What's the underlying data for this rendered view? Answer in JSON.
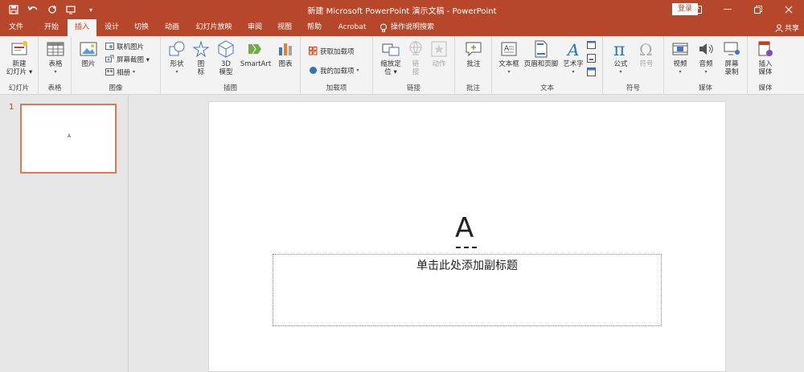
{
  "titlebar": {
    "doc_title": "新建 Microsoft PowerPoint 演示文稿 - PowerPoint",
    "login": "登录"
  },
  "tabs": [
    "文件",
    "开始",
    "插入",
    "设计",
    "切换",
    "动画",
    "幻灯片放映",
    "审阅",
    "视图",
    "帮助",
    "Acrobat",
    "操作说明搜索"
  ],
  "active_tab": "插入",
  "share": "共享",
  "ribbon": {
    "groups": {
      "slides": "幻灯片",
      "tables": "表格",
      "images": "图像",
      "illustrations": "插图",
      "addins": "加载项",
      "links": "链接",
      "comments": "批注",
      "text": "文本",
      "symbols": "符号",
      "media": "媒体",
      "media2": "媒体"
    },
    "new_slide": [
      "新建",
      "幻灯片 ▾"
    ],
    "table": "表格",
    "picture": "图片",
    "online_picture": "联机图片",
    "screenshot": "屏幕截图 ▾",
    "album": "相册",
    "shapes": "形状",
    "icons": [
      "图",
      "标"
    ],
    "model3d": [
      "3D",
      "模型"
    ],
    "smartart": "SmartArt",
    "chart": "图表",
    "get_addins": "获取加载项",
    "my_addins": "我的加载项",
    "zoom": [
      "缩放定",
      "位 ▾"
    ],
    "link": [
      "链",
      "接"
    ],
    "action": "动作",
    "comment": "批注",
    "textbox": "文本框",
    "header_footer": "页眉和页脚",
    "wordart": "艺术字",
    "equation": "公式",
    "symbol": "符号",
    "video": "视频",
    "audio": "音频",
    "screen_record": [
      "屏幕",
      "录制"
    ],
    "insert_media": [
      "插入",
      "媒体"
    ]
  },
  "thumbnail": {
    "number": "1",
    "mark": "A"
  },
  "slide": {
    "title": "A",
    "subtitle_placeholder": "单击此处添加副标题"
  },
  "colors": {
    "accent": "#b7472a",
    "selection": "#e4774f"
  }
}
